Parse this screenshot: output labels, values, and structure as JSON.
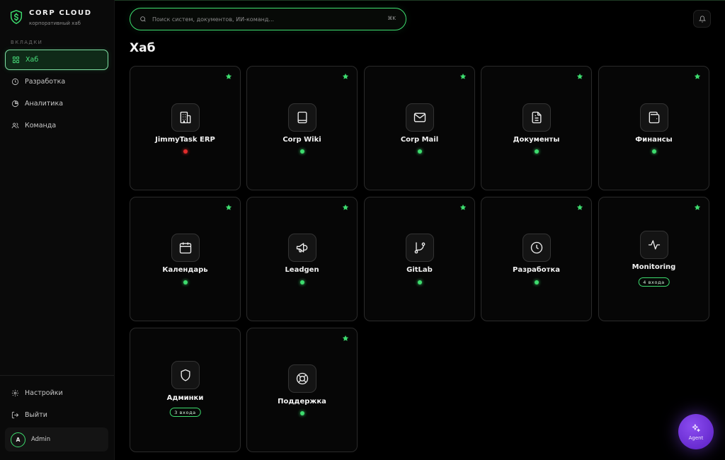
{
  "brand": {
    "title": "CORP CLOUD",
    "subtitle": "корпоративный хаб"
  },
  "sidebar": {
    "section_label": "ВКЛАДКИ",
    "items": [
      {
        "label": "Хаб",
        "icon": "grid-icon",
        "active": true
      },
      {
        "label": "Разработка",
        "icon": "clock-icon"
      },
      {
        "label": "Аналитика",
        "icon": "pie-chart-icon"
      },
      {
        "label": "Команда",
        "icon": "users-icon"
      }
    ],
    "bottom": [
      {
        "label": "Настройки",
        "icon": "gear-icon"
      },
      {
        "label": "Выйти",
        "icon": "logout-icon"
      }
    ],
    "user": {
      "initial": "A",
      "name": "Admin"
    }
  },
  "search": {
    "placeholder": "Поиск систем, документов, ИИ-команд...",
    "shortcut": "⌘K"
  },
  "page": {
    "title": "Хаб"
  },
  "cards": [
    {
      "label": "JimmyTask ERP",
      "icon": "building-icon",
      "status": "red",
      "starred": true
    },
    {
      "label": "Corp Wiki",
      "icon": "book-icon",
      "status": "green",
      "starred": true
    },
    {
      "label": "Corp Mail",
      "icon": "mail-icon",
      "status": "green",
      "starred": true
    },
    {
      "label": "Документы",
      "icon": "document-icon",
      "status": "green",
      "starred": true
    },
    {
      "label": "Финансы",
      "icon": "wallet-icon",
      "status": "green",
      "starred": true
    },
    {
      "label": "Календарь",
      "icon": "calendar-icon",
      "status": "green",
      "starred": true
    },
    {
      "label": "Leadgen",
      "icon": "megaphone-icon",
      "status": "green",
      "starred": true
    },
    {
      "label": "GitLab",
      "icon": "git-branch-icon",
      "status": "green",
      "starred": true
    },
    {
      "label": "Разработка",
      "icon": "clock-icon",
      "status": "green",
      "starred": true
    },
    {
      "label": "Monitoring",
      "icon": "activity-icon",
      "badge": "4 входа",
      "starred": true
    },
    {
      "label": "Админки",
      "icon": "shield-icon",
      "badge": "3 входа",
      "starred": false
    },
    {
      "label": "Поддержка",
      "icon": "lifebuoy-icon",
      "status": "green",
      "starred": true
    }
  ],
  "agent": {
    "label": "Agent"
  },
  "colors": {
    "accent": "#3ddc6e",
    "error": "#e02b2b",
    "agent": "#7a3de8"
  }
}
